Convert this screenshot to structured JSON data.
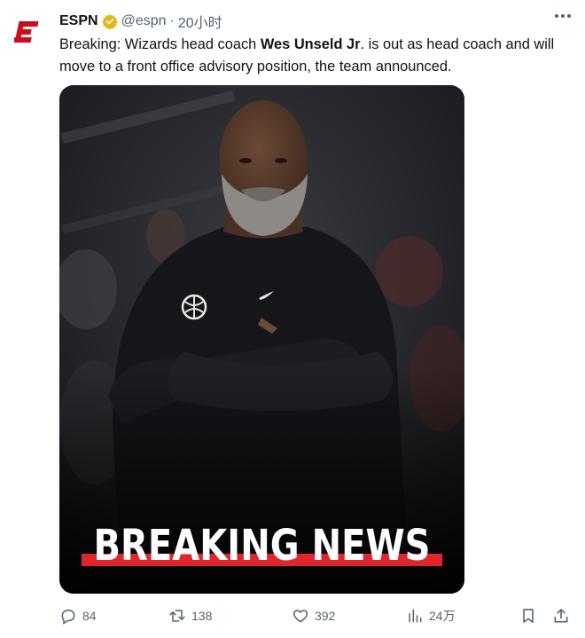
{
  "author": {
    "name": "ESPN",
    "handle": "@espn",
    "separator": "·",
    "time": "20小时",
    "verified": true,
    "avatar_icon": "espn-e-logo",
    "avatar_color": "#d00b1c"
  },
  "tweet": {
    "text_before": "Breaking: Wizards head coach ",
    "text_bold": "Wes Unseld Jr",
    "text_after": ". is out as head coach and will move to a front office advisory position, the team announced."
  },
  "media": {
    "banner_text": "BREAKING NEWS",
    "banner_underline_color": "#e0262d",
    "subject": "man-with-crossed-arms-photo"
  },
  "actions": {
    "reply_count": "84",
    "retweet_count": "138",
    "like_count": "392",
    "views_count": "24万"
  },
  "colors": {
    "text_primary": "#0f1419",
    "text_secondary": "#536471",
    "verified_gold": "#e2b719"
  }
}
